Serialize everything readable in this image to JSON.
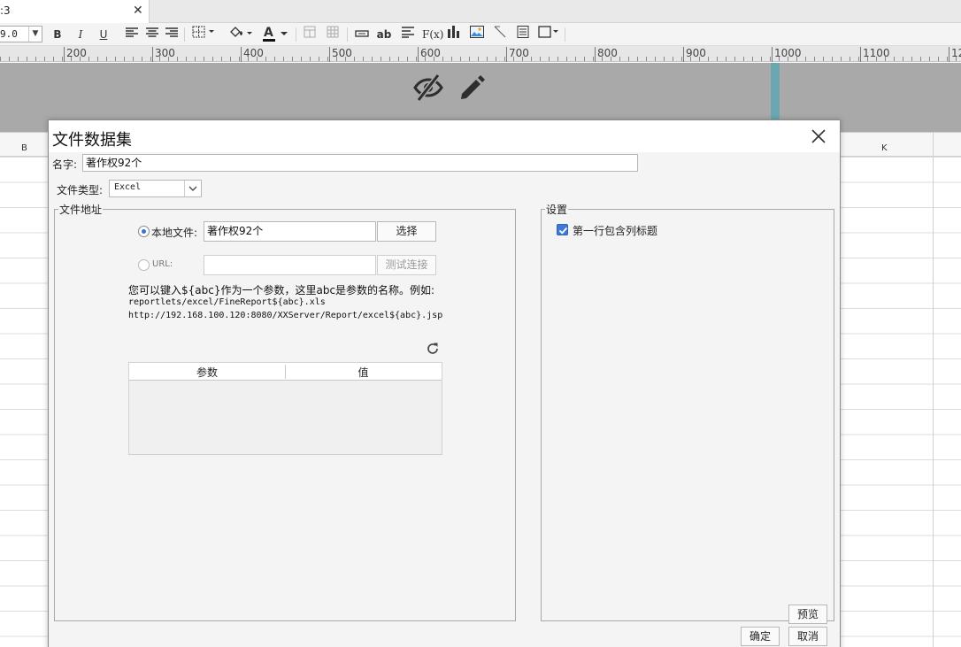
{
  "tab": {
    "title": ":3",
    "close_glyph": "✕"
  },
  "toolbar": {
    "font_size": "9.0",
    "bold": "B",
    "italic": "I",
    "underline": "U",
    "font_color_glyph": "A",
    "text_glyph": "ab",
    "formula_glyph": "F(x)"
  },
  "ruler": {
    "labels": [
      "200",
      "300",
      "400",
      "500",
      "600",
      "700",
      "800",
      "900",
      "1000",
      "1100",
      "12"
    ]
  },
  "sheet": {
    "columns": [
      "B",
      "K"
    ]
  },
  "dialog": {
    "title": "文件数据集",
    "name_label": "名字:",
    "name_value": "著作权92个",
    "file_type_label": "文件类型:",
    "file_type_value": "Excel",
    "file_address_group": "文件地址",
    "local_file_label": "本地文件:",
    "local_file_value": "著作权92个",
    "choose_button": "选择",
    "url_label": "URL:",
    "url_value": "",
    "test_connection_button": "测试连接",
    "hint_line1": "您可以键入${abc}作为一个参数，这里abc是参数的名称。例如:",
    "hint_line2": "reportlets/excel/FineReport${abc}.xls",
    "hint_line3": "http://192.168.100.120:8080/XXServer/Report/excel${abc}.jsp",
    "param_headers": [
      "参数",
      "值"
    ],
    "settings_group": "设置",
    "first_row_header_label": "第一行包含列标题",
    "first_row_header_checked": true,
    "preview_button": "预览",
    "ok_button": "确定",
    "cancel_button": "取消"
  },
  "colors": {
    "design_area": "#a9a9a9",
    "guide_line": "#6aa7b3",
    "accent": "#3b7ad9"
  },
  "icons": [
    "close-icon",
    "eye-slash-icon",
    "pencil-icon",
    "refresh-icon",
    "checkmark-icon",
    "chevron-down-icon"
  ]
}
